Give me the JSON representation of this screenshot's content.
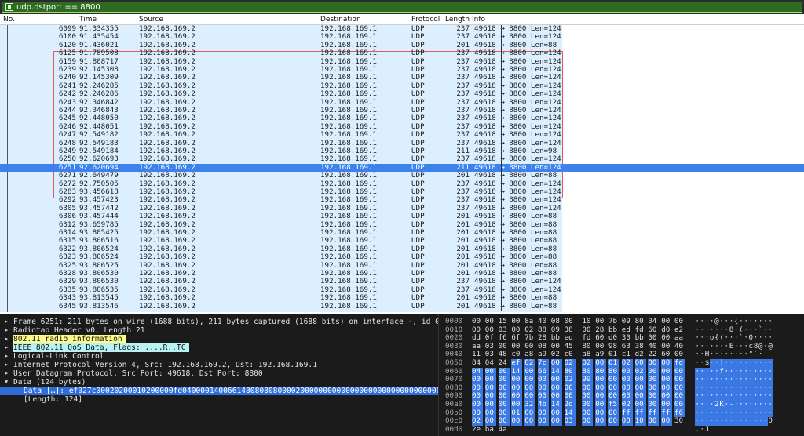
{
  "filter": {
    "text": "udp.dstport == 8800",
    "bookmark_icon": "bookmark-icon"
  },
  "columns": {
    "no": "No.",
    "time": "Time",
    "source": "Source",
    "destination": "Destination",
    "protocol": "Protocol",
    "length": "Length",
    "info": "Info"
  },
  "packets": [
    {
      "no": "6099",
      "time": "91.334355",
      "src": "192.168.169.2",
      "dst": "192.168.169.1",
      "proto": "UDP",
      "len": "237",
      "info": "49618 → 8800 Len=124"
    },
    {
      "no": "6100",
      "time": "91.435454",
      "src": "192.168.169.2",
      "dst": "192.168.169.1",
      "proto": "UDP",
      "len": "237",
      "info": "49618 → 8800 Len=124"
    },
    {
      "no": "6120",
      "time": "91.436021",
      "src": "192.168.169.2",
      "dst": "192.168.169.1",
      "proto": "UDP",
      "len": "201",
      "info": "49618 → 8800 Len=88"
    },
    {
      "no": "6125",
      "time": "91.789508",
      "src": "192.168.169.2",
      "dst": "192.168.169.1",
      "proto": "UDP",
      "len": "237",
      "info": "49618 → 8800 Len=124"
    },
    {
      "no": "6159",
      "time": "91.808717",
      "src": "192.168.169.2",
      "dst": "192.168.169.1",
      "proto": "UDP",
      "len": "237",
      "info": "49618 → 8800 Len=124"
    },
    {
      "no": "6239",
      "time": "92.145308",
      "src": "192.168.169.2",
      "dst": "192.168.169.1",
      "proto": "UDP",
      "len": "237",
      "info": "49618 → 8800 Len=124"
    },
    {
      "no": "6240",
      "time": "92.145309",
      "src": "192.168.169.2",
      "dst": "192.168.169.1",
      "proto": "UDP",
      "len": "237",
      "info": "49618 → 8800 Len=124"
    },
    {
      "no": "6241",
      "time": "92.246285",
      "src": "192.168.169.2",
      "dst": "192.168.169.1",
      "proto": "UDP",
      "len": "237",
      "info": "49618 → 8800 Len=124"
    },
    {
      "no": "6242",
      "time": "92.246286",
      "src": "192.168.169.2",
      "dst": "192.168.169.1",
      "proto": "UDP",
      "len": "237",
      "info": "49618 → 8800 Len=124"
    },
    {
      "no": "6243",
      "time": "92.346842",
      "src": "192.168.169.2",
      "dst": "192.168.169.1",
      "proto": "UDP",
      "len": "237",
      "info": "49618 → 8800 Len=124"
    },
    {
      "no": "6244",
      "time": "92.346843",
      "src": "192.168.169.2",
      "dst": "192.168.169.1",
      "proto": "UDP",
      "len": "237",
      "info": "49618 → 8800 Len=124"
    },
    {
      "no": "6245",
      "time": "92.448050",
      "src": "192.168.169.2",
      "dst": "192.168.169.1",
      "proto": "UDP",
      "len": "237",
      "info": "49618 → 8800 Len=124"
    },
    {
      "no": "6246",
      "time": "92.448051",
      "src": "192.168.169.2",
      "dst": "192.168.169.1",
      "proto": "UDP",
      "len": "237",
      "info": "49618 → 8800 Len=124"
    },
    {
      "no": "6247",
      "time": "92.549182",
      "src": "192.168.169.2",
      "dst": "192.168.169.1",
      "proto": "UDP",
      "len": "237",
      "info": "49618 → 8800 Len=124"
    },
    {
      "no": "6248",
      "time": "92.549183",
      "src": "192.168.169.2",
      "dst": "192.168.169.1",
      "proto": "UDP",
      "len": "237",
      "info": "49618 → 8800 Len=124"
    },
    {
      "no": "6249",
      "time": "92.549184",
      "src": "192.168.169.2",
      "dst": "192.168.169.1",
      "proto": "UDP",
      "len": "211",
      "info": "49618 → 8800 Len=98"
    },
    {
      "no": "6250",
      "time": "92.620693",
      "src": "192.168.169.2",
      "dst": "192.168.169.1",
      "proto": "UDP",
      "len": "237",
      "info": "49618 → 8800 Len=124"
    },
    {
      "no": "6251",
      "time": "92.620694",
      "src": "192.168.169.2",
      "dst": "192.168.169.1",
      "proto": "UDP",
      "len": "211",
      "info": "49618 → 8800 Len=124",
      "selected": true
    },
    {
      "no": "6271",
      "time": "92.649479",
      "src": "192.168.169.2",
      "dst": "192.168.169.1",
      "proto": "UDP",
      "len": "201",
      "info": "49618 → 8800 Len=88"
    },
    {
      "no": "6272",
      "time": "92.750505",
      "src": "192.168.169.2",
      "dst": "192.168.169.1",
      "proto": "UDP",
      "len": "237",
      "info": "49618 → 8800 Len=124"
    },
    {
      "no": "6283",
      "time": "93.456618",
      "src": "192.168.169.2",
      "dst": "192.168.169.1",
      "proto": "UDP",
      "len": "237",
      "info": "49618 → 8800 Len=124"
    },
    {
      "no": "6292",
      "time": "93.457423",
      "src": "192.168.169.2",
      "dst": "192.168.169.1",
      "proto": "UDP",
      "len": "237",
      "info": "49618 → 8800 Len=124"
    },
    {
      "no": "6305",
      "time": "93.457442",
      "src": "192.168.169.2",
      "dst": "192.168.169.1",
      "proto": "UDP",
      "len": "237",
      "info": "49618 → 8800 Len=124"
    },
    {
      "no": "6306",
      "time": "93.457444",
      "src": "192.168.169.2",
      "dst": "192.168.169.1",
      "proto": "UDP",
      "len": "201",
      "info": "49618 → 8800 Len=88"
    },
    {
      "no": "6312",
      "time": "93.659785",
      "src": "192.168.169.2",
      "dst": "192.168.169.1",
      "proto": "UDP",
      "len": "201",
      "info": "49618 → 8800 Len=88"
    },
    {
      "no": "6314",
      "time": "93.805425",
      "src": "192.168.169.2",
      "dst": "192.168.169.1",
      "proto": "UDP",
      "len": "201",
      "info": "49618 → 8800 Len=88"
    },
    {
      "no": "6315",
      "time": "93.806516",
      "src": "192.168.169.2",
      "dst": "192.168.169.1",
      "proto": "UDP",
      "len": "201",
      "info": "49618 → 8800 Len=88"
    },
    {
      "no": "6322",
      "time": "93.806524",
      "src": "192.168.169.2",
      "dst": "192.168.169.1",
      "proto": "UDP",
      "len": "201",
      "info": "49618 → 8800 Len=88"
    },
    {
      "no": "6323",
      "time": "93.806524",
      "src": "192.168.169.2",
      "dst": "192.168.169.1",
      "proto": "UDP",
      "len": "201",
      "info": "49618 → 8800 Len=88"
    },
    {
      "no": "6325",
      "time": "93.806525",
      "src": "192.168.169.2",
      "dst": "192.168.169.1",
      "proto": "UDP",
      "len": "201",
      "info": "49618 → 8800 Len=88"
    },
    {
      "no": "6328",
      "time": "93.806530",
      "src": "192.168.169.2",
      "dst": "192.168.169.1",
      "proto": "UDP",
      "len": "201",
      "info": "49618 → 8800 Len=88"
    },
    {
      "no": "6329",
      "time": "93.806530",
      "src": "192.168.169.2",
      "dst": "192.168.169.1",
      "proto": "UDP",
      "len": "237",
      "info": "49618 → 8800 Len=124"
    },
    {
      "no": "6335",
      "time": "93.806535",
      "src": "192.168.169.2",
      "dst": "192.168.169.1",
      "proto": "UDP",
      "len": "237",
      "info": "49618 → 8800 Len=124"
    },
    {
      "no": "6343",
      "time": "93.813545",
      "src": "192.168.169.2",
      "dst": "192.168.169.1",
      "proto": "UDP",
      "len": "201",
      "info": "49618 → 8800 Len=88"
    },
    {
      "no": "6345",
      "time": "93.813546",
      "src": "192.168.169.2",
      "dst": "192.168.169.1",
      "proto": "UDP",
      "len": "201",
      "info": "49618 → 8800 Len=88"
    }
  ],
  "details": [
    {
      "text": "Frame 6251: 211 bytes on wire (1688 bits), 211 bytes captured (1688 bits) on interface -, id 0",
      "style": "normal"
    },
    {
      "text": "Radiotap Header v0, Length 21",
      "style": "normal"
    },
    {
      "text": "802.11 radio information",
      "style": "yellow"
    },
    {
      "text": "IEEE 802.11 QoS Data, Flags: ....R..TC",
      "style": "cyan"
    },
    {
      "text": "Logical-Link Control",
      "style": "normal"
    },
    {
      "text": "Internet Protocol Version 4, Src: 192.168.169.2, Dst: 192.168.169.1",
      "style": "normal"
    },
    {
      "text": "User Datagram Protocol, Src Port: 49618, Dst Port: 8800",
      "style": "normal"
    },
    {
      "text": "Data (124 bytes)",
      "style": "open"
    },
    {
      "text": "Data […]: ef027c00020200010200000fd0400001400661480808080000200000000000000000000000000000002990000000000000",
      "style": "blue"
    },
    {
      "text": "[Length: 124]",
      "style": "plain-indent"
    }
  ],
  "hex": [
    {
      "off": "0000",
      "bytes": [
        "00",
        "00",
        "15",
        "00",
        "8a",
        "40",
        "08",
        "00",
        "10",
        "00",
        "7b",
        "09",
        "80",
        "04",
        "00",
        "00"
      ],
      "ascii": "····@···{·······"
    },
    {
      "off": "0010",
      "bytes": [
        "00",
        "00",
        "03",
        "00",
        "02",
        "88",
        "09",
        "38",
        "00",
        "28",
        "bb",
        "ed",
        "fd",
        "60",
        "d0",
        "e2"
      ],
      "ascii": "·······8·(···`··"
    },
    {
      "off": "0020",
      "bytes": [
        "dd",
        "0f",
        "f6",
        "6f",
        "7b",
        "28",
        "bb",
        "ed",
        "fd",
        "60",
        "d0",
        "30",
        "bb",
        "00",
        "00",
        "aa"
      ],
      "ascii": "···o{(···`·0····"
    },
    {
      "off": "0030",
      "bytes": [
        "aa",
        "03",
        "00",
        "00",
        "00",
        "08",
        "00",
        "45",
        "80",
        "00",
        "98",
        "63",
        "38",
        "40",
        "00",
        "40"
      ],
      "ascii": "·······E···c8@·@"
    },
    {
      "off": "0040",
      "bytes": [
        "11",
        "03",
        "48",
        "c0",
        "a8",
        "a9",
        "02",
        "c0",
        "a8",
        "a9",
        "01",
        "c1",
        "d2",
        "22",
        "60",
        "00"
      ],
      "ascii": "··H········\"`·"
    },
    {
      "off": "0050",
      "bytes": [
        "84",
        "04",
        "24",
        "ef",
        "02",
        "7c",
        "00",
        "02",
        "02",
        "00",
        "01",
        "02",
        "00",
        "00",
        "00",
        "fd"
      ],
      "ascii": "··$··|··········"
    },
    {
      "off": "0060",
      "bytes": [
        "04",
        "00",
        "00",
        "14",
        "00",
        "66",
        "14",
        "80",
        "80",
        "80",
        "80",
        "00",
        "02",
        "00",
        "00",
        "00"
      ],
      "ascii": "·····f··········"
    },
    {
      "off": "0070",
      "bytes": [
        "00",
        "00",
        "00",
        "00",
        "00",
        "00",
        "00",
        "02",
        "99",
        "00",
        "00",
        "00",
        "00",
        "00",
        "00",
        "00"
      ],
      "ascii": "················"
    },
    {
      "off": "0080",
      "bytes": [
        "00",
        "00",
        "00",
        "00",
        "00",
        "00",
        "00",
        "00",
        "00",
        "00",
        "00",
        "00",
        "00",
        "00",
        "00",
        "00"
      ],
      "ascii": "················"
    },
    {
      "off": "0090",
      "bytes": [
        "00",
        "00",
        "00",
        "00",
        "00",
        "00",
        "00",
        "00",
        "00",
        "00",
        "00",
        "00",
        "00",
        "00",
        "00",
        "00"
      ],
      "ascii": "················"
    },
    {
      "off": "00a0",
      "bytes": [
        "00",
        "00",
        "00",
        "00",
        "32",
        "4b",
        "14",
        "2d",
        "00",
        "00",
        "f5",
        "02",
        "00",
        "00",
        "00",
        "00"
      ],
      "ascii": "····2K·-········"
    },
    {
      "off": "00b0",
      "bytes": [
        "00",
        "00",
        "00",
        "01",
        "00",
        "00",
        "00",
        "14",
        "00",
        "00",
        "00",
        "ff",
        "ff",
        "ff",
        "ff",
        "f6"
      ],
      "ascii": "················"
    },
    {
      "off": "00c0",
      "bytes": [
        "02",
        "00",
        "00",
        "00",
        "00",
        "00",
        "00",
        "03",
        "00",
        "00",
        "00",
        "00",
        "10",
        "00",
        "00",
        "30"
      ],
      "ascii": "···············0"
    },
    {
      "off": "00d0",
      "bytes": [
        "2e",
        "ba",
        "4a"
      ],
      "ascii": ".·J"
    }
  ]
}
